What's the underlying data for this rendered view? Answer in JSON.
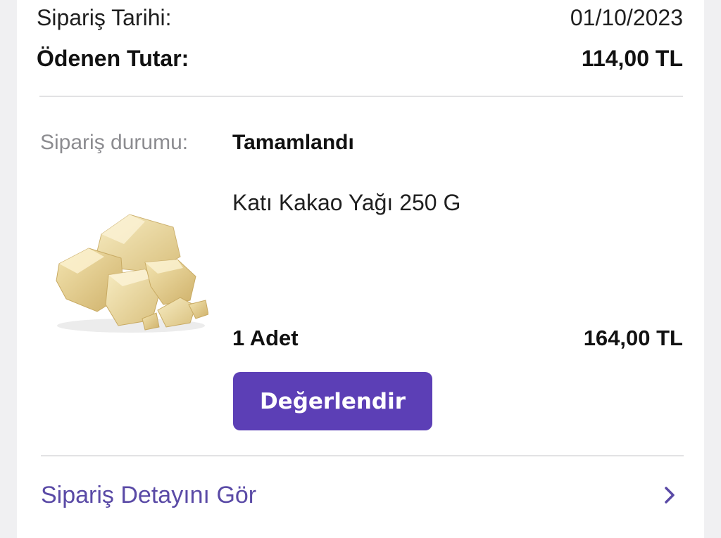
{
  "order": {
    "date_label": "Sipariş Tarihi:",
    "date_value": "01/10/2023",
    "paid_label": "Ödenen Tutar:",
    "paid_value": "114,00 TL"
  },
  "status": {
    "label": "Sipariş durumu:",
    "value": "Tamamlandı"
  },
  "product": {
    "name": "Katı Kakao Yağı 250 G",
    "image_icon": "cocoa-butter-image",
    "quantity": "1 Adet",
    "price": "164,00 TL"
  },
  "actions": {
    "rate_label": "Değerlendir",
    "detail_label": "Sipariş Detayını Gör",
    "detail_icon": "chevron-right-icon"
  },
  "colors": {
    "accent": "#5c3fb6",
    "link": "#5a4aa6",
    "muted": "#8c8c90"
  }
}
